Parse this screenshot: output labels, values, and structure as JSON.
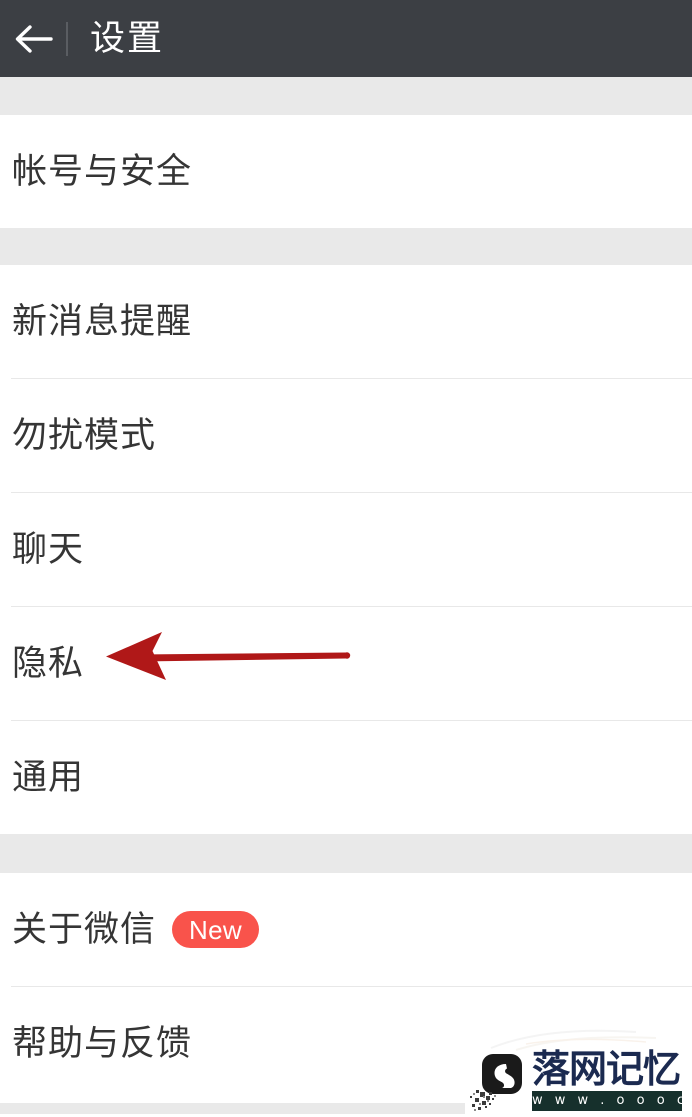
{
  "header": {
    "title": "设置",
    "back_icon": "back-arrow-icon",
    "background_color": "#3c3f44"
  },
  "sections": [
    {
      "id": "account",
      "rows": [
        {
          "label": "帐号与安全",
          "badge": null
        }
      ]
    },
    {
      "id": "notifications",
      "rows": [
        {
          "label": "新消息提醒",
          "badge": null
        },
        {
          "label": "勿扰模式",
          "badge": null
        },
        {
          "label": "聊天",
          "badge": null
        },
        {
          "label": "隐私",
          "badge": null
        },
        {
          "label": "通用",
          "badge": null
        }
      ]
    },
    {
      "id": "about",
      "rows": [
        {
          "label": "关于微信",
          "badge": "New"
        },
        {
          "label": "帮助与反馈",
          "badge": null
        }
      ]
    }
  ],
  "annotation": {
    "type": "arrow",
    "direction": "left",
    "color": "#b01818",
    "points_to": "隐私"
  },
  "badge_colors": {
    "new_badge_background": "#f9534b",
    "new_badge_text": "#ffffff"
  },
  "watermark": {
    "title": "落网记忆",
    "url": "w w w . o o o c . c n",
    "icon": "swan-app-icon",
    "url_bar_color": "#16302c",
    "title_color": "#1b2a50"
  }
}
